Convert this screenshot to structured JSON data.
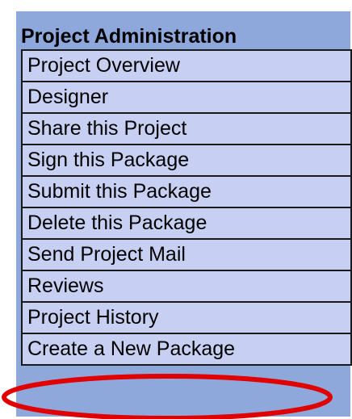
{
  "panel": {
    "title": "Project Administration"
  },
  "menu": {
    "items": [
      {
        "label": "Project Overview"
      },
      {
        "label": "Designer"
      },
      {
        "label": "Share this Project"
      },
      {
        "label": "Sign this Package"
      },
      {
        "label": "Submit this Package"
      },
      {
        "label": "Delete this Package"
      },
      {
        "label": "Send Project Mail"
      },
      {
        "label": "Reviews"
      },
      {
        "label": "Project History"
      },
      {
        "label": "Create a New Package"
      }
    ]
  },
  "annotation": {
    "highlight_color": "#e00000",
    "highlighted_item": "Create a New Package"
  },
  "colors": {
    "panel_background": "#8fa8dc",
    "item_background": "#c7d0f2",
    "border": "#1a1a1a"
  }
}
